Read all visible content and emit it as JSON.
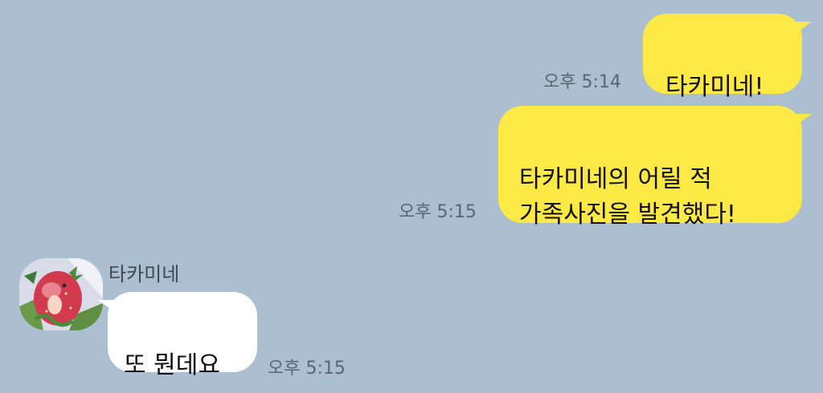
{
  "chat": {
    "messages": [
      {
        "sender": "me",
        "text": "타카미네!",
        "time": "오후 5:14"
      },
      {
        "sender": "me",
        "text": "타카미네의 어릴 적\n가족사진을 발견했다!",
        "time": "오후 5:15"
      },
      {
        "sender": "other",
        "name": "타카미네",
        "text": "또 뭔데요",
        "time": "오후 5:15"
      }
    ]
  },
  "colors": {
    "background": "#abbfd0",
    "my_bubble": "#fde946",
    "other_bubble": "#ffffff"
  },
  "icons": {
    "avatar": "strawberry-character-avatar"
  }
}
